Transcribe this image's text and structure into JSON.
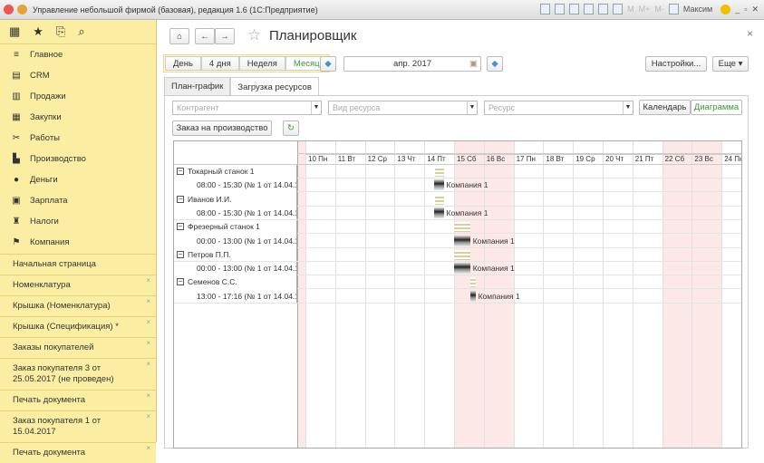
{
  "window": {
    "title": "Управление небольшой фирмой (базовая), редакция 1.6  (1С:Предприятие)",
    "user": "Максим",
    "toolbar_labels": [
      "M",
      "M+",
      "M-"
    ]
  },
  "sidebar": {
    "items": [
      {
        "icon": "menu-lines-icon",
        "label": "Главное"
      },
      {
        "icon": "crm-icon",
        "label": "CRM"
      },
      {
        "icon": "sales-icon",
        "label": "Продажи"
      },
      {
        "icon": "cart-icon",
        "label": "Закупки"
      },
      {
        "icon": "tools-icon",
        "label": "Работы"
      },
      {
        "icon": "factory-icon",
        "label": "Производство"
      },
      {
        "icon": "money-icon",
        "label": "Деньги"
      },
      {
        "icon": "wallet-icon",
        "label": "Зарплата"
      },
      {
        "icon": "taxes-icon",
        "label": "Налоги"
      },
      {
        "icon": "flag-icon",
        "label": "Компания"
      }
    ],
    "open_windows": [
      "Начальная страница",
      "Номенклатура",
      "Крышка (Номенклатура)",
      "Крышка (Спецификация) *",
      "Заказы покупателей",
      "Заказ покупателя 3 от 25.05.2017 (не проведен)",
      "Печать документа",
      "Заказ покупателя 1 от 15.04.2017",
      "Печать документа"
    ]
  },
  "header": {
    "title": "Планировщик",
    "close": "×"
  },
  "periods": [
    "День",
    "4 дня",
    "Неделя",
    "Месяц"
  ],
  "active_period": "Месяц",
  "period_value": "апр. 2017",
  "settings_label": "Настройки...",
  "more_label": "Еще ▾",
  "tabs": [
    "План-график",
    "Загрузка ресурсов"
  ],
  "filters": {
    "counterparty": "Контрагент",
    "resource_kind": "Вид ресурса",
    "resource": "Ресурс"
  },
  "view_toggle": [
    "Календарь",
    "Диаграмма"
  ],
  "order_button": "Заказ на производство",
  "days": [
    "10 Пн",
    "11 Вт",
    "12 Ср",
    "13 Чт",
    "14 Пт",
    "15 Сб",
    "16 Вс",
    "17 Пн",
    "18 Вт",
    "19 Ср",
    "20 Чт",
    "21 Пт",
    "22 Сб",
    "23 Вс",
    "24 Пн"
  ],
  "weekend_days": [
    5,
    6,
    12,
    13
  ],
  "rows": [
    {
      "type": "group",
      "label": "Токарный станок 1",
      "start": 4.35,
      "end": 4.65
    },
    {
      "type": "item",
      "label": "08:00 - 15:30 (№ 1 от 14.04.17)",
      "bar": "Компания 1",
      "start": 4.33,
      "end": 4.65
    },
    {
      "type": "group",
      "label": "Иванов И.И.",
      "start": 4.35,
      "end": 4.65
    },
    {
      "type": "item",
      "label": "08:00 - 15:30 (№ 1 от 14.04.17)",
      "bar": "Компания 1",
      "start": 4.33,
      "end": 4.65
    },
    {
      "type": "group",
      "label": "Фрезерный станок 1",
      "start": 5.0,
      "end": 5.54
    },
    {
      "type": "item",
      "label": "00:00 - 13:00 (№ 1 от 14.04.17)",
      "bar": "Компания 1",
      "start": 5.0,
      "end": 5.54
    },
    {
      "type": "group",
      "label": "Петров П.П.",
      "start": 5.0,
      "end": 5.54
    },
    {
      "type": "item",
      "label": "00:00 - 13:00 (№ 1 от 14.04.17)",
      "bar": "Компания 1",
      "start": 5.0,
      "end": 5.54
    },
    {
      "type": "group",
      "label": "Семенов С.С.",
      "start": 5.54,
      "end": 5.72
    },
    {
      "type": "item",
      "label": "13:00 - 17:16 (№ 1 от 14.04.17)",
      "bar": "Компания 1",
      "start": 5.54,
      "end": 5.72
    }
  ]
}
